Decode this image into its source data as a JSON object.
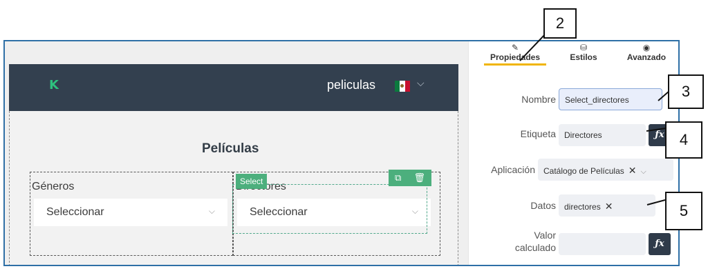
{
  "app": {
    "logo": "K",
    "name": "peliculas",
    "flag_icon": "mexico-flag-icon"
  },
  "canvas": {
    "page_title": "Películas",
    "generos": {
      "label": "Géneros",
      "value": "Seleccionar"
    },
    "directores": {
      "label": "Directores",
      "value": "Seleccionar"
    },
    "selected_badge": "Select"
  },
  "panel": {
    "tabs": [
      {
        "label": "Propiedades",
        "icon": "pencil-icon",
        "active": true
      },
      {
        "label": "Estilos",
        "icon": "paint-bucket-icon",
        "active": false
      },
      {
        "label": "Avanzado",
        "icon": "eye-icon",
        "active": false
      }
    ],
    "fields": {
      "nombre": {
        "label": "Nombre",
        "value": "Select_directores"
      },
      "etiqueta": {
        "label": "Etiqueta",
        "value": "Directores"
      },
      "aplicacion": {
        "label": "Aplicación",
        "value": "Catálogo de Películas"
      },
      "datos": {
        "label": "Datos",
        "value": "directores"
      },
      "valor_calculado": {
        "label_line1": "Valor",
        "label_line2": "calculado",
        "value": ""
      }
    },
    "fx_label": "ƒx"
  },
  "callouts": [
    "2",
    "3",
    "4",
    "5"
  ],
  "colors": {
    "header_bg": "#33404f",
    "accent_green": "#4caf7d",
    "tab_active": "#f0b400",
    "frame_border": "#2e6fa6"
  }
}
